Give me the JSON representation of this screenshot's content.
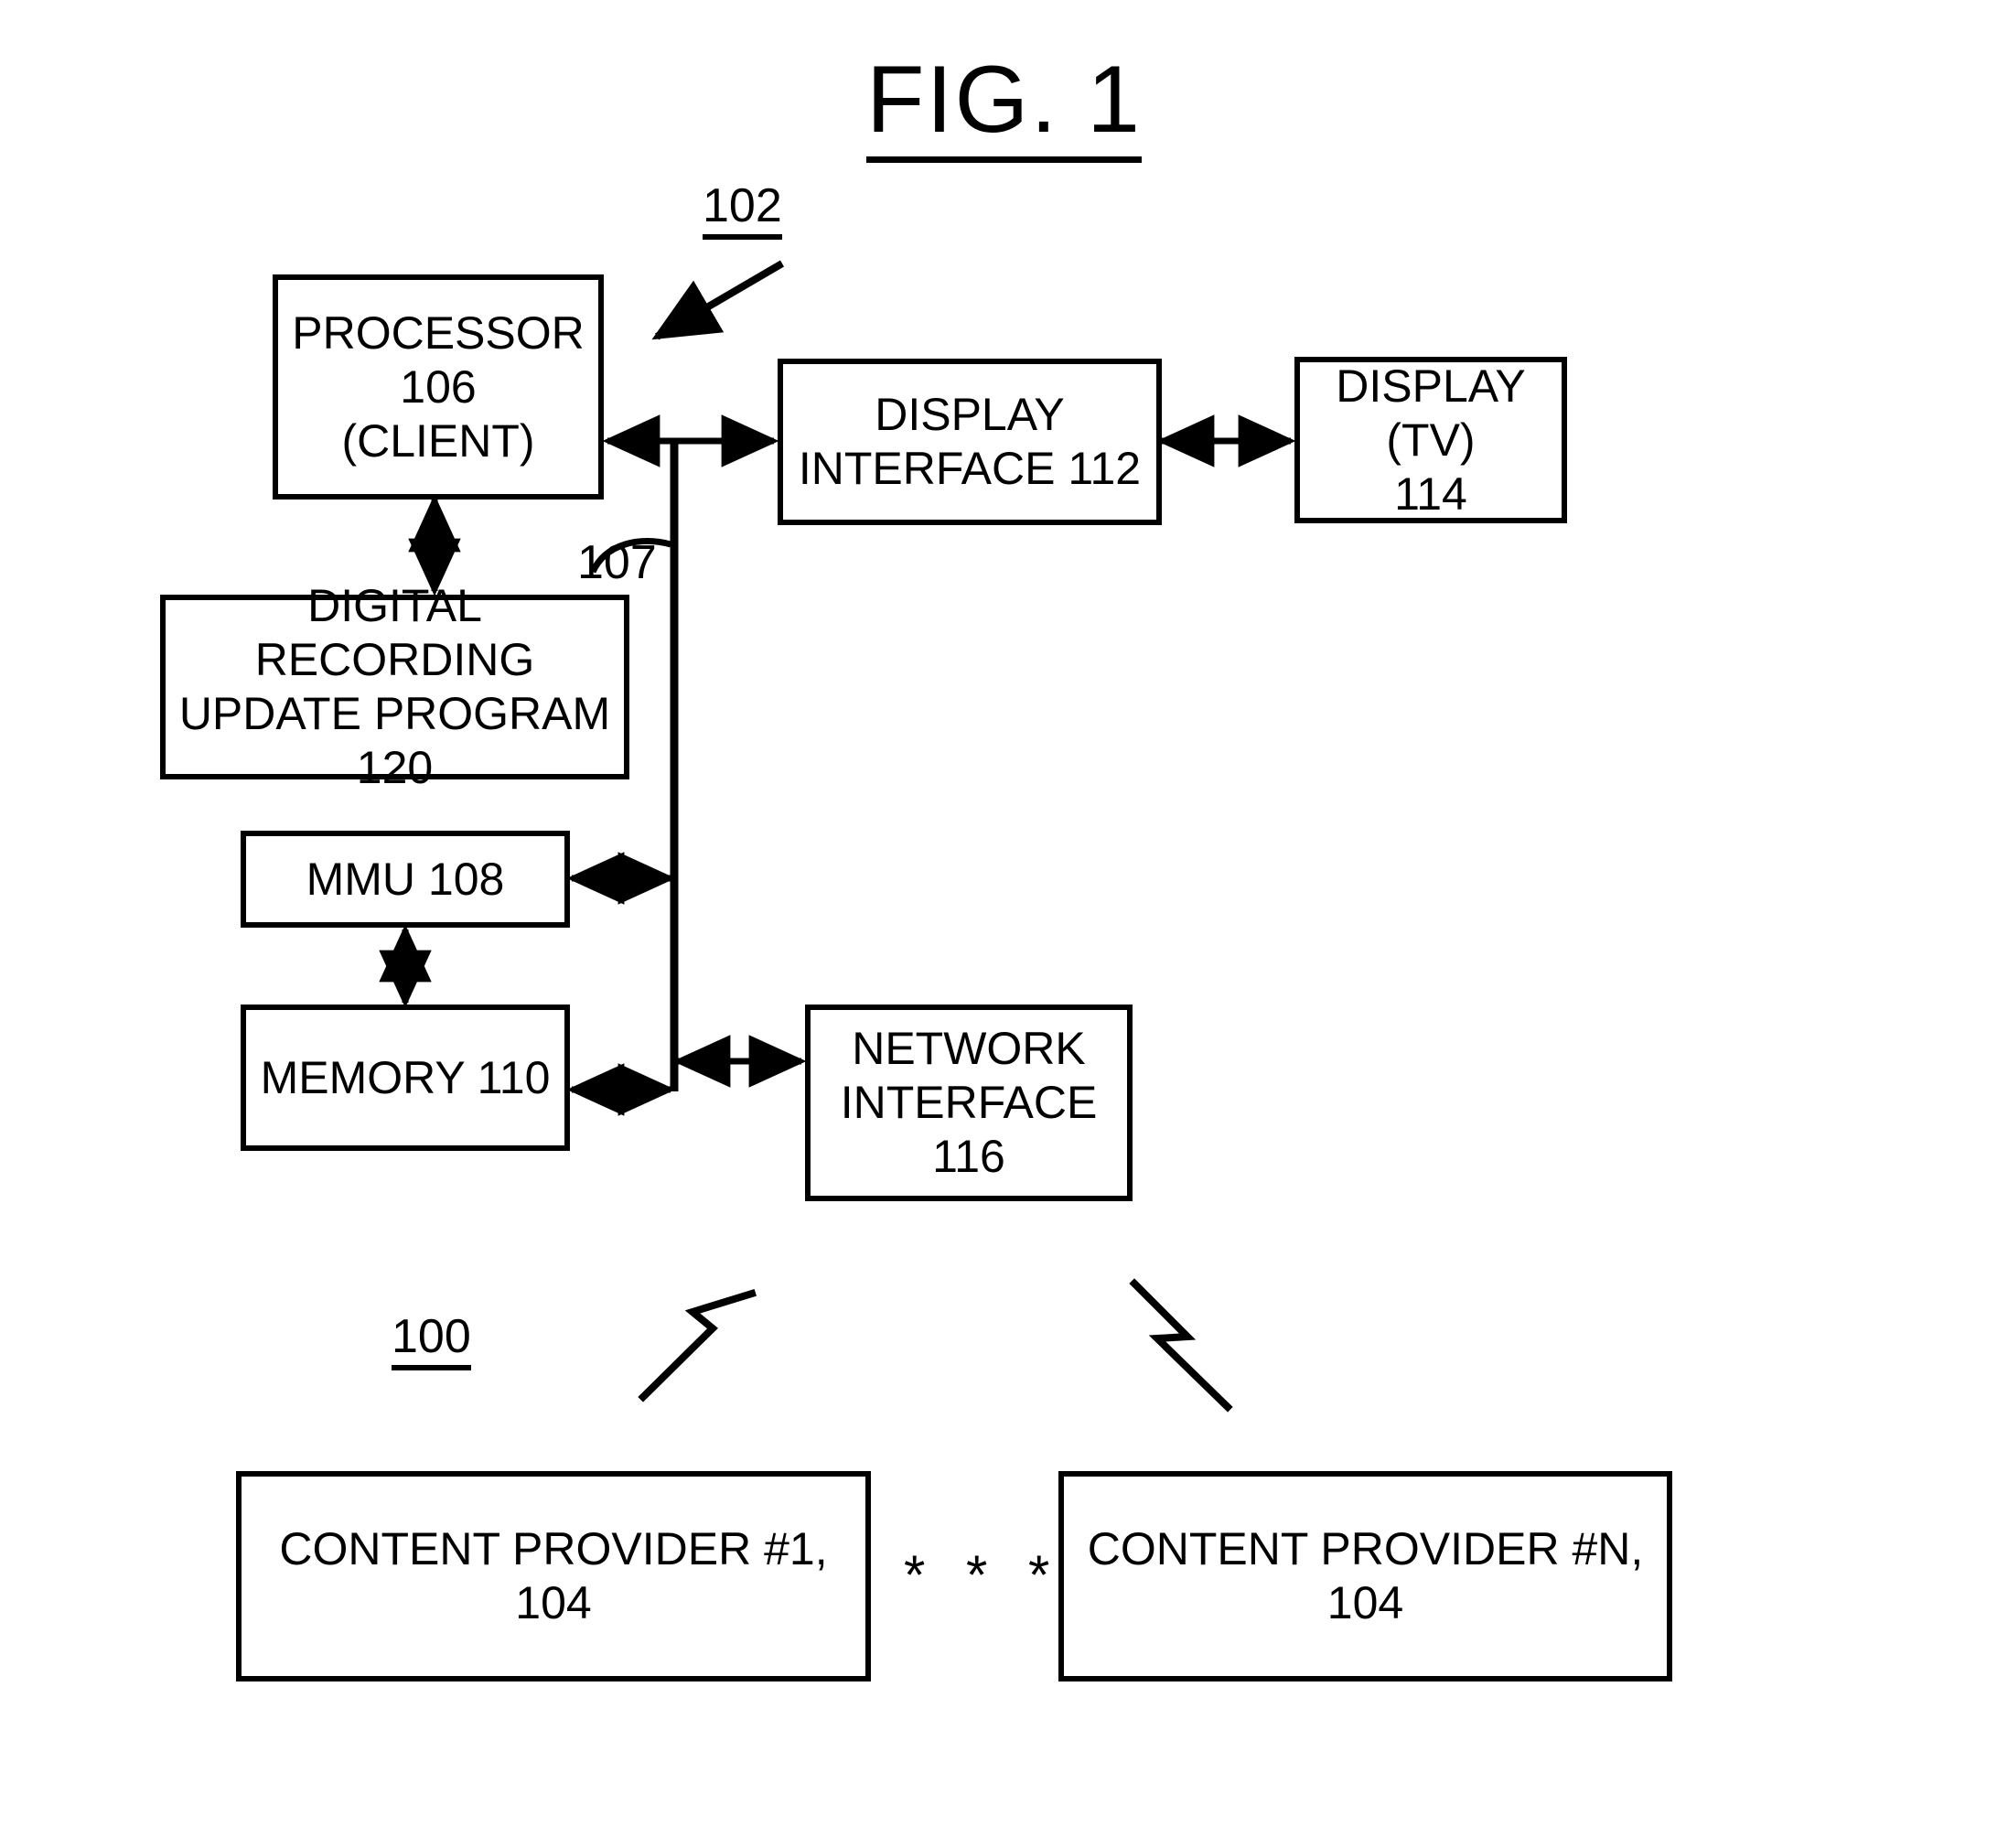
{
  "figure": {
    "title": "FIG. 1",
    "system_label": "100",
    "device_label": "102",
    "bus_label": "107",
    "multiplicity_marker": "* * *"
  },
  "nodes": {
    "processor": {
      "text": "PROCESSOR\n106\n(CLIENT)"
    },
    "display_interface": {
      "text": "DISPLAY\nINTERFACE 112"
    },
    "display_tv": {
      "text": "DISPLAY\n(TV)\n114"
    },
    "update_program": {
      "text": "DIGITAL RECORDING\nUPDATE PROGRAM\n120"
    },
    "mmu": {
      "text": "MMU 108"
    },
    "memory": {
      "text": "MEMORY 110"
    },
    "network_interface": {
      "text": "NETWORK\nINTERFACE\n116"
    },
    "content_provider_first": {
      "text": "CONTENT PROVIDER #1, 104"
    },
    "content_provider_nth": {
      "text": "CONTENT PROVIDER #N, 104"
    }
  },
  "colors": {
    "stroke": "#000000",
    "background": "#ffffff"
  }
}
